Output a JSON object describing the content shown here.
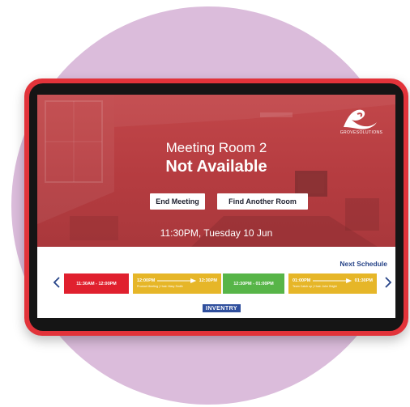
{
  "logo": {
    "text": "GROVESOLUTIONS"
  },
  "room": {
    "name": "Meeting Room 2",
    "status": "Not Available"
  },
  "actions": {
    "end_meeting": "End Meeting",
    "find_room": "Find Another Room"
  },
  "datetime": "11:30PM, Tuesday 10 Jun",
  "schedule": {
    "heading": "Next Schedule",
    "slots": [
      {
        "start": "11:30AM",
        "end": "12:00PM",
        "detail": "",
        "color": "#e0202e"
      },
      {
        "start": "12:00PM",
        "end": "12:30PM",
        "detail": "Product Meeting | Host: Mary Smith",
        "color": "#e6b628"
      },
      {
        "start": "12:30PM",
        "end": "01:00PM",
        "detail": "",
        "color": "#57b548"
      },
      {
        "start": "01:00PM",
        "end": "01:30PM",
        "detail": "Team Catch up | Host: John Bright",
        "color": "#e6b628"
      }
    ]
  },
  "brand": {
    "text": "INVENTRY"
  },
  "colors": {
    "accent_red": "#e2333a",
    "background_circle": "#dbbcdb",
    "brand_blue": "#2f4f9d",
    "link_blue": "#274488"
  }
}
